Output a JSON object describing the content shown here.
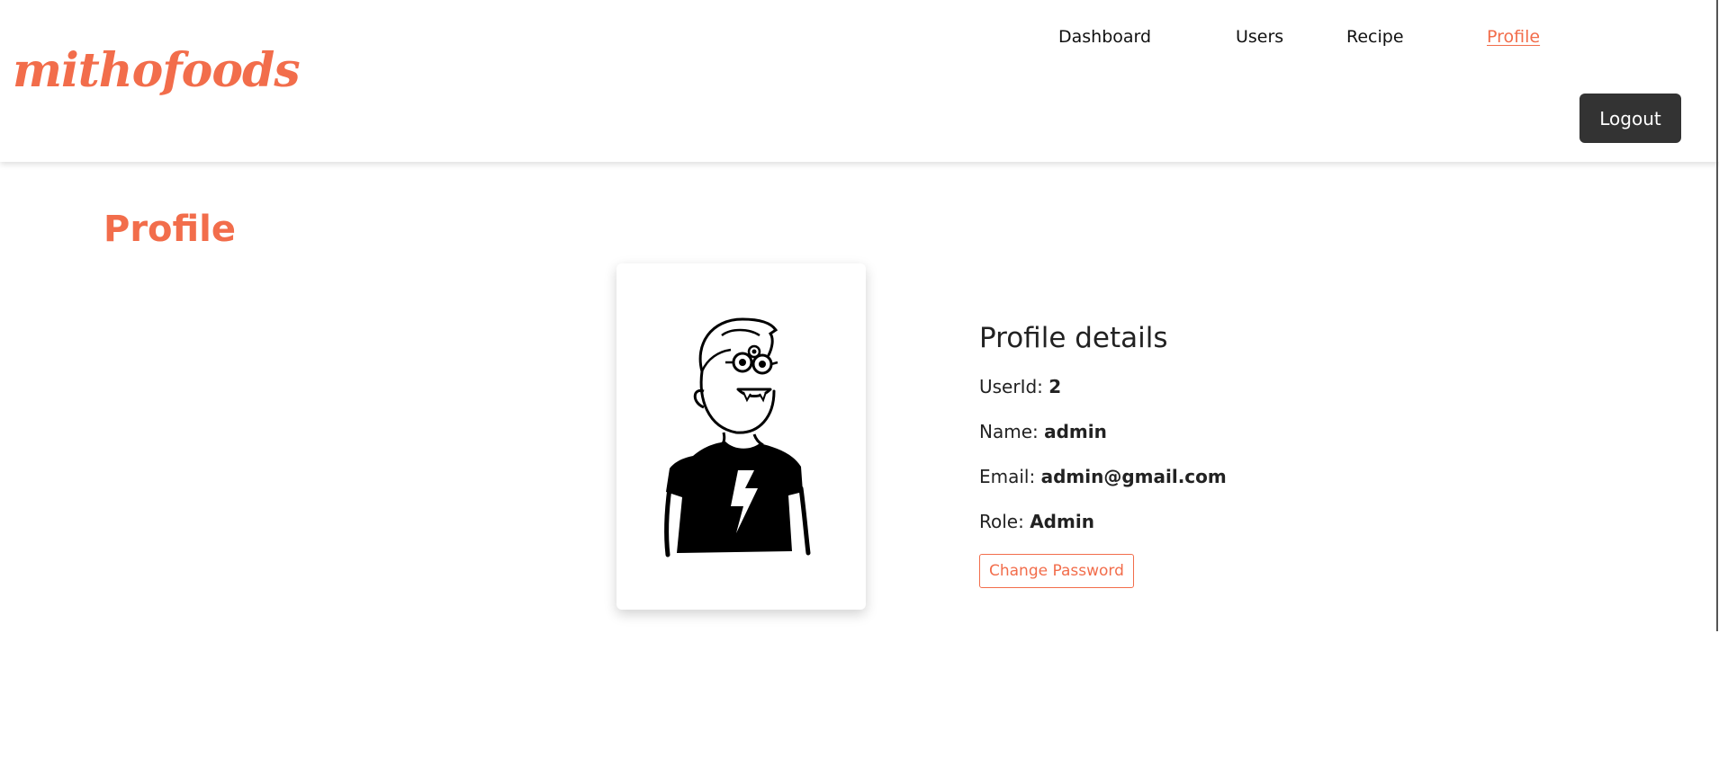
{
  "brand": {
    "logo_text": "mithofoods",
    "accent_color": "#f26d4b"
  },
  "nav": {
    "items": [
      {
        "label": "Dashboard"
      },
      {
        "label": "Users"
      },
      {
        "label": "Recipe"
      },
      {
        "label": "Profile",
        "active": true
      }
    ],
    "logout_label": "Logout"
  },
  "page": {
    "title": "Profile"
  },
  "profile": {
    "heading": "Profile details",
    "userid_label": "UserId:",
    "userid_value": "2",
    "name_label": "Name:",
    "name_value": "admin",
    "email_label": "Email:",
    "email_value": "admin@gmail.com",
    "role_label": "Role:",
    "role_value": "Admin",
    "change_password_label": "Change Password",
    "avatar_icon": "cartoon-person-avatar"
  }
}
